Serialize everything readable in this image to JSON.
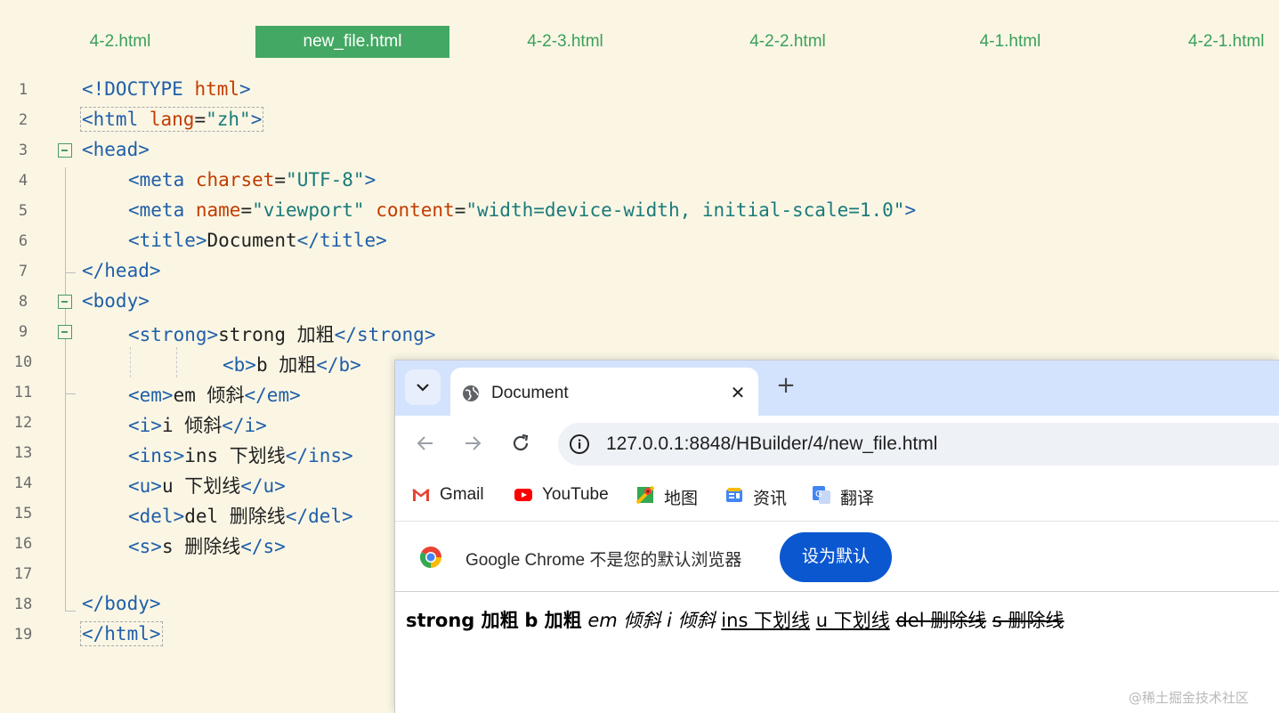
{
  "editor": {
    "tabs": [
      {
        "label": "4-2.html",
        "active": false
      },
      {
        "label": "new_file.html",
        "active": true
      },
      {
        "label": "4-2-3.html",
        "active": false
      },
      {
        "label": "4-2-2.html",
        "active": false
      },
      {
        "label": "4-1.html",
        "active": false
      },
      {
        "label": "4-2-1.html",
        "active": false
      }
    ],
    "line_numbers": [
      "1",
      "2",
      "3",
      "4",
      "5",
      "6",
      "7",
      "8",
      "9",
      "10",
      "11",
      "12",
      "13",
      "14",
      "15",
      "16",
      "17",
      "18",
      "19"
    ],
    "code": {
      "l1_open": "<!DOCTYPE",
      "l1_attr": "html",
      "l1_close": ">",
      "l2_tag": "<html",
      "l2_attr": "lang",
      "l2_eq": "=",
      "l2_val": "\"zh\"",
      "l2_close": ">",
      "l3": "<head>",
      "l4_tag": "<meta",
      "l4_attr": "charset",
      "l4_eq": "=",
      "l4_val": "\"UTF-8\"",
      "l4_close": ">",
      "l5_tag": "<meta",
      "l5_attr1": "name",
      "l5_eq1": "=",
      "l5_val1": "\"viewport\"",
      "l5_attr2": "content",
      "l5_eq2": "=",
      "l5_val2": "\"width=device-width, initial-scale=1.0\"",
      "l5_close": ">",
      "l6_open": "<title>",
      "l6_text": "Document",
      "l6_close": "</title>",
      "l7": "</head>",
      "l8": "<body>",
      "l9_open": "<strong>",
      "l9_text": "strong 加粗",
      "l9_close": "</strong>",
      "l10_open": "<b>",
      "l10_text": "b 加粗",
      "l10_close": "</b>",
      "l11_open": "<em>",
      "l11_text": "em 倾斜",
      "l11_close": "</em>",
      "l12_open": "<i>",
      "l12_text": "i 倾斜",
      "l12_close": "</i>",
      "l13_open": "<ins>",
      "l13_text": "ins 下划线",
      "l13_close": "</ins>",
      "l14_open": "<u>",
      "l14_text": "u 下划线",
      "l14_close": "</u>",
      "l15_open": "<del>",
      "l15_text": "del 删除线",
      "l15_close": "</del>",
      "l16_open": "<s>",
      "l16_text": "s 删除线",
      "l16_close": "</s>",
      "l18": "</body>",
      "l19": "</html>"
    }
  },
  "browser": {
    "tab_title": "Document",
    "close_glyph": "✕",
    "new_tab_glyph": "+",
    "url": "127.0.0.1:8848/HBuilder/4/new_file.html",
    "bookmarks": [
      {
        "label": "Gmail",
        "icon": "gmail-icon"
      },
      {
        "label": "YouTube",
        "icon": "youtube-icon"
      },
      {
        "label": "地图",
        "icon": "maps-icon"
      },
      {
        "label": "资讯",
        "icon": "news-icon"
      },
      {
        "label": "翻译",
        "icon": "translate-icon"
      }
    ],
    "infobar_text": "Google Chrome 不是您的默认浏览器",
    "set_default_label": "设为默认",
    "rendered": {
      "strong": "strong 加粗",
      "b": "b 加粗",
      "em": "em 倾斜",
      "i": "i 倾斜",
      "ins": "ins 下划线",
      "u": "u 下划线",
      "del": "del 删除线",
      "s": "s 删除线"
    }
  },
  "watermark": "@稀土掘金技术社区",
  "colors": {
    "editor_bg": "#fbf6e4",
    "tab_active_bg": "#43a863",
    "tab_text": "#3aa05a",
    "tag": "#1f5fa8",
    "attr": "#c23c00",
    "value": "#1a7a7a",
    "browser_tabstrip": "#d3e3fd",
    "primary_button": "#0b57d0"
  }
}
